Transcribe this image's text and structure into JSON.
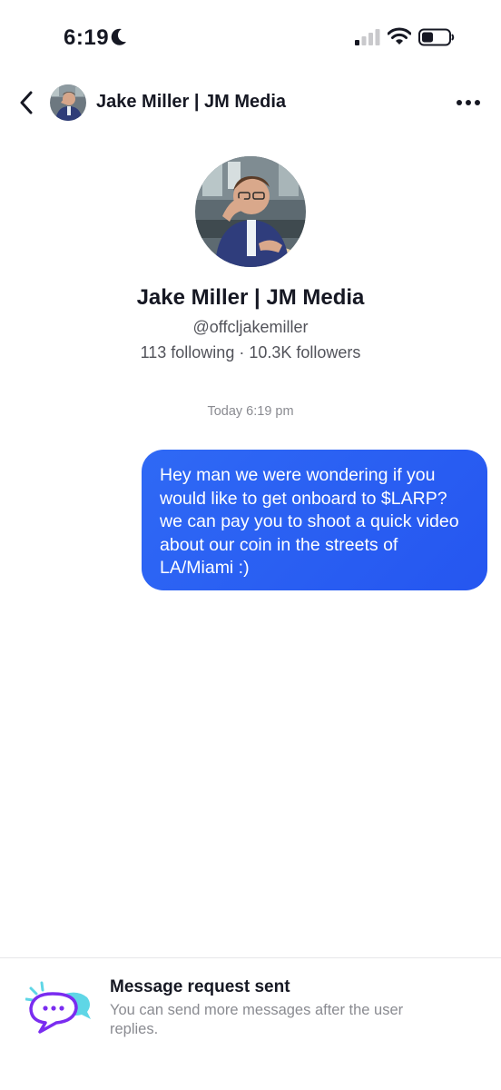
{
  "status_bar": {
    "time": "6:19",
    "icons": [
      "moon-icon",
      "signal-icon",
      "wifi-icon",
      "battery-icon"
    ]
  },
  "nav": {
    "title": "Jake Miller | JM Media",
    "icons": [
      "chevron-left-icon",
      "more-icon"
    ]
  },
  "profile": {
    "name": "Jake Miller | JM Media",
    "handle": "@offcljakemiller",
    "stats": "113 following · 10.3K followers"
  },
  "conversation": {
    "timestamp": "Today 6:19 pm",
    "messages": [
      {
        "direction": "outgoing",
        "text": "Hey man we were wondering if you would like to get onboard to $LARP? we can pay you to shoot a quick video about our coin in the streets of LA/Miami :)"
      }
    ]
  },
  "request_banner": {
    "title": "Message request sent",
    "subtitle": "You can send more messages after the user replies.",
    "icon": "message-request-icon"
  },
  "colors": {
    "bubble": "#2f69f5",
    "text_primary": "#161823",
    "text_secondary": "#8a8b91",
    "accent_purple": "#7a2cf0",
    "accent_teal": "#5fd6e6"
  }
}
